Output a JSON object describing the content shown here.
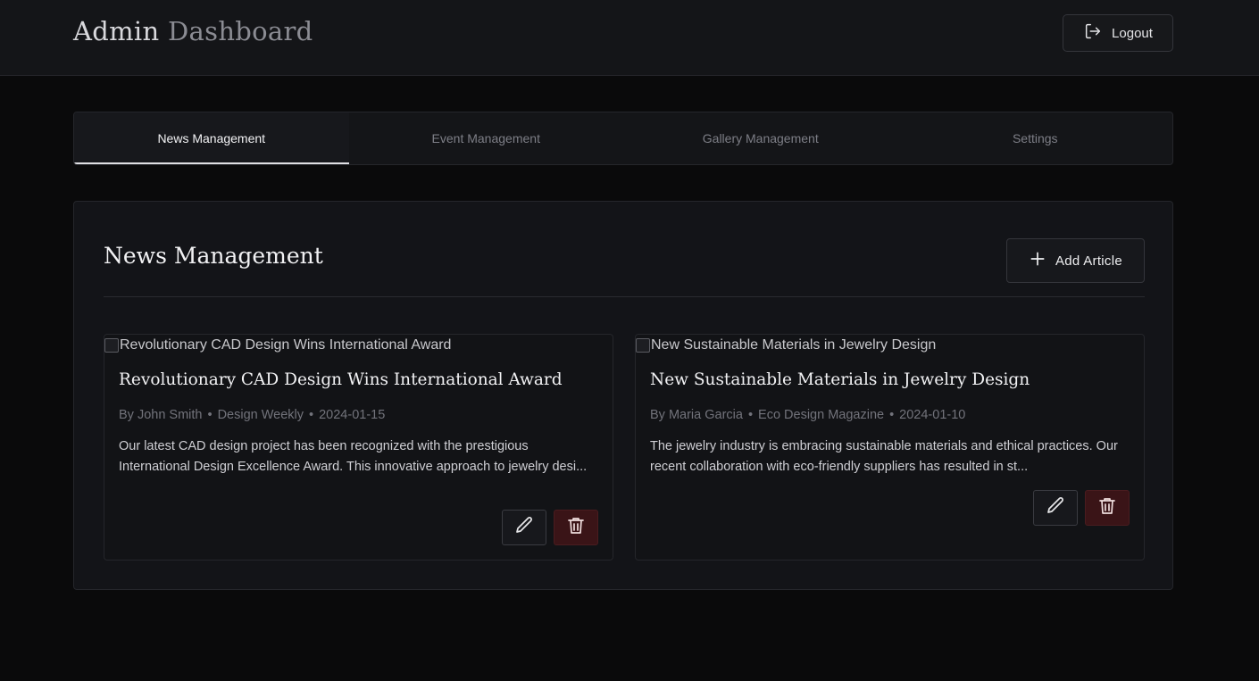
{
  "header": {
    "brand_word1": "Admin",
    "brand_word2": "Dashboard",
    "logout_label": "Logout",
    "logout_icon": "logout-icon"
  },
  "tabs": [
    {
      "label": "News Management",
      "active": true
    },
    {
      "label": "Event Management",
      "active": false
    },
    {
      "label": "Gallery Management",
      "active": false
    },
    {
      "label": "Settings",
      "active": false
    }
  ],
  "panel": {
    "title": "News Management",
    "add_label": "Add Article",
    "add_icon": "plus-icon"
  },
  "articles": [
    {
      "image_alt": "Revolutionary CAD Design Wins International Award",
      "title": "Revolutionary CAD Design Wins International Award",
      "author": "By John Smith",
      "source": "Design Weekly",
      "date": "2024-01-15",
      "excerpt": "Our latest CAD design project has been recognized with the prestigious International Design Excellence Award. This innovative approach to jewelry desi..."
    },
    {
      "image_alt": "New Sustainable Materials in Jewelry Design",
      "title": "New Sustainable Materials in Jewelry Design",
      "author": "By Maria Garcia",
      "source": "Eco Design Magazine",
      "date": "2024-01-10",
      "excerpt": "The jewelry industry is embracing sustainable materials and ethical practices. Our recent collaboration with eco-friendly suppliers has resulted in st..."
    }
  ],
  "meta_separator": "•",
  "colors": {
    "background": "#0a0a0b",
    "surface": "#141518",
    "delete_bg": "#3a1417",
    "delete_icon": "#e8b4b4"
  }
}
